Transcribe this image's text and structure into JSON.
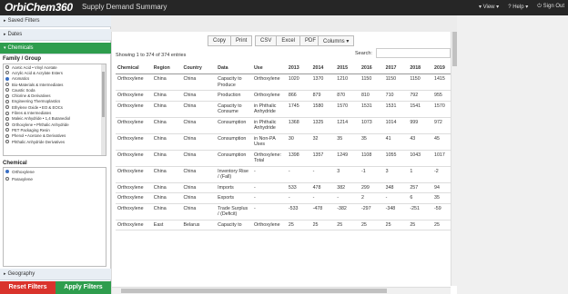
{
  "app": {
    "logo": "OrbiChem360",
    "title": "Supply Demand Summary",
    "menu": [
      "▾ View ▾",
      "? Help ▾",
      "⏻ Sign Out"
    ]
  },
  "sidebar": {
    "saved_filters": "Saved Filters",
    "dates": "Dates",
    "chemicals": "Chemicals",
    "family_title": "Family / Group",
    "families": [
      "Acetic Acid • Vinyl Acetate",
      "Acrylic Acid & Acrylate Esters",
      "Aromatics",
      "Bio-Materials & Intermediates",
      "Caustic Soda",
      "Chlorine & Derivatives",
      "Engineering Thermoplastics",
      "Ethylene Oxide • EO & EOCs",
      "Fibres & Intermediates",
      "Maleic Anhydride • 1,4 Butanediol",
      "Orthoxylene • Phthalic Anhydride",
      "PET Packaging Resin",
      "Phenol • Acetone & Derivatives",
      "Phthalic Anhydride Derivatives"
    ],
    "selected_family_index": 2,
    "chemical_title": "Chemical",
    "chemicals_list": [
      "Orthoxylene",
      "Paraxylene"
    ],
    "selected_chemical_index": 0,
    "geography": "Geography",
    "reset": "Reset Filters",
    "apply": "Apply Filters"
  },
  "toolbar": {
    "group1": [
      "Copy",
      "Print"
    ],
    "group2": [
      "CSV",
      "Excel",
      "PDF"
    ],
    "columns": "Columns ▾"
  },
  "table_info": {
    "showing": "Showing 1 to 374 of 374 entries",
    "search_label": "Search:"
  },
  "table": {
    "headers": [
      "Chemical",
      "Region",
      "Country",
      "Data",
      "Use",
      "2013",
      "2014",
      "2015",
      "2016",
      "2017",
      "2018",
      "2019"
    ],
    "rows": [
      [
        "Orthoxylene",
        "China",
        "China",
        "Capacity to Produce",
        "Orthoxylene",
        "1020",
        "1370",
        "1210",
        "1150",
        "1150",
        "1150",
        "1415"
      ],
      [
        "Orthoxylene",
        "China",
        "China",
        "Production",
        "Orthoxylene",
        "866",
        "879",
        "870",
        "810",
        "710",
        "792",
        "955"
      ],
      [
        "Orthoxylene",
        "China",
        "China",
        "Capacity to Consume",
        "in Phthalic Anhydride",
        "1745",
        "1580",
        "1570",
        "1531",
        "1531",
        "1541",
        "1570"
      ],
      [
        "Orthoxylene",
        "China",
        "China",
        "Consumption",
        "in Phthalic Anhydride",
        "1368",
        "1325",
        "1214",
        "1073",
        "1014",
        "999",
        "972"
      ],
      [
        "Orthoxylene",
        "China",
        "China",
        "Consumption",
        "in Non-PA Uses",
        "30",
        "32",
        "35",
        "35",
        "41",
        "43",
        "45"
      ],
      [
        "Orthoxylene",
        "China",
        "China",
        "Consumption",
        "Orthoxylene: Total",
        "1398",
        "1357",
        "1249",
        "1108",
        "1055",
        "1043",
        "1017"
      ],
      [
        "Orthoxylene",
        "China",
        "China",
        "Inventory Rise / (Fall)",
        "-",
        "-",
        "-",
        "3",
        "-1",
        "3",
        "1",
        "-2"
      ],
      [
        "Orthoxylene",
        "China",
        "China",
        "Imports",
        "-",
        "533",
        "478",
        "382",
        "299",
        "348",
        "257",
        "94"
      ],
      [
        "Orthoxylene",
        "China",
        "China",
        "Exports",
        "-",
        "-",
        "-",
        "-",
        "2",
        "-",
        "6",
        "35"
      ],
      [
        "Orthoxylene",
        "China",
        "China",
        "Trade Surplus / (Deficit)",
        "-",
        "-533",
        "-478",
        "-382",
        "-297",
        "-348",
        "-251",
        "-59"
      ],
      [
        "Orthoxylene",
        "East",
        "Belarus",
        "Capacity to",
        "Orthoxylene",
        "25",
        "25",
        "25",
        "25",
        "25",
        "25",
        "25"
      ]
    ]
  }
}
